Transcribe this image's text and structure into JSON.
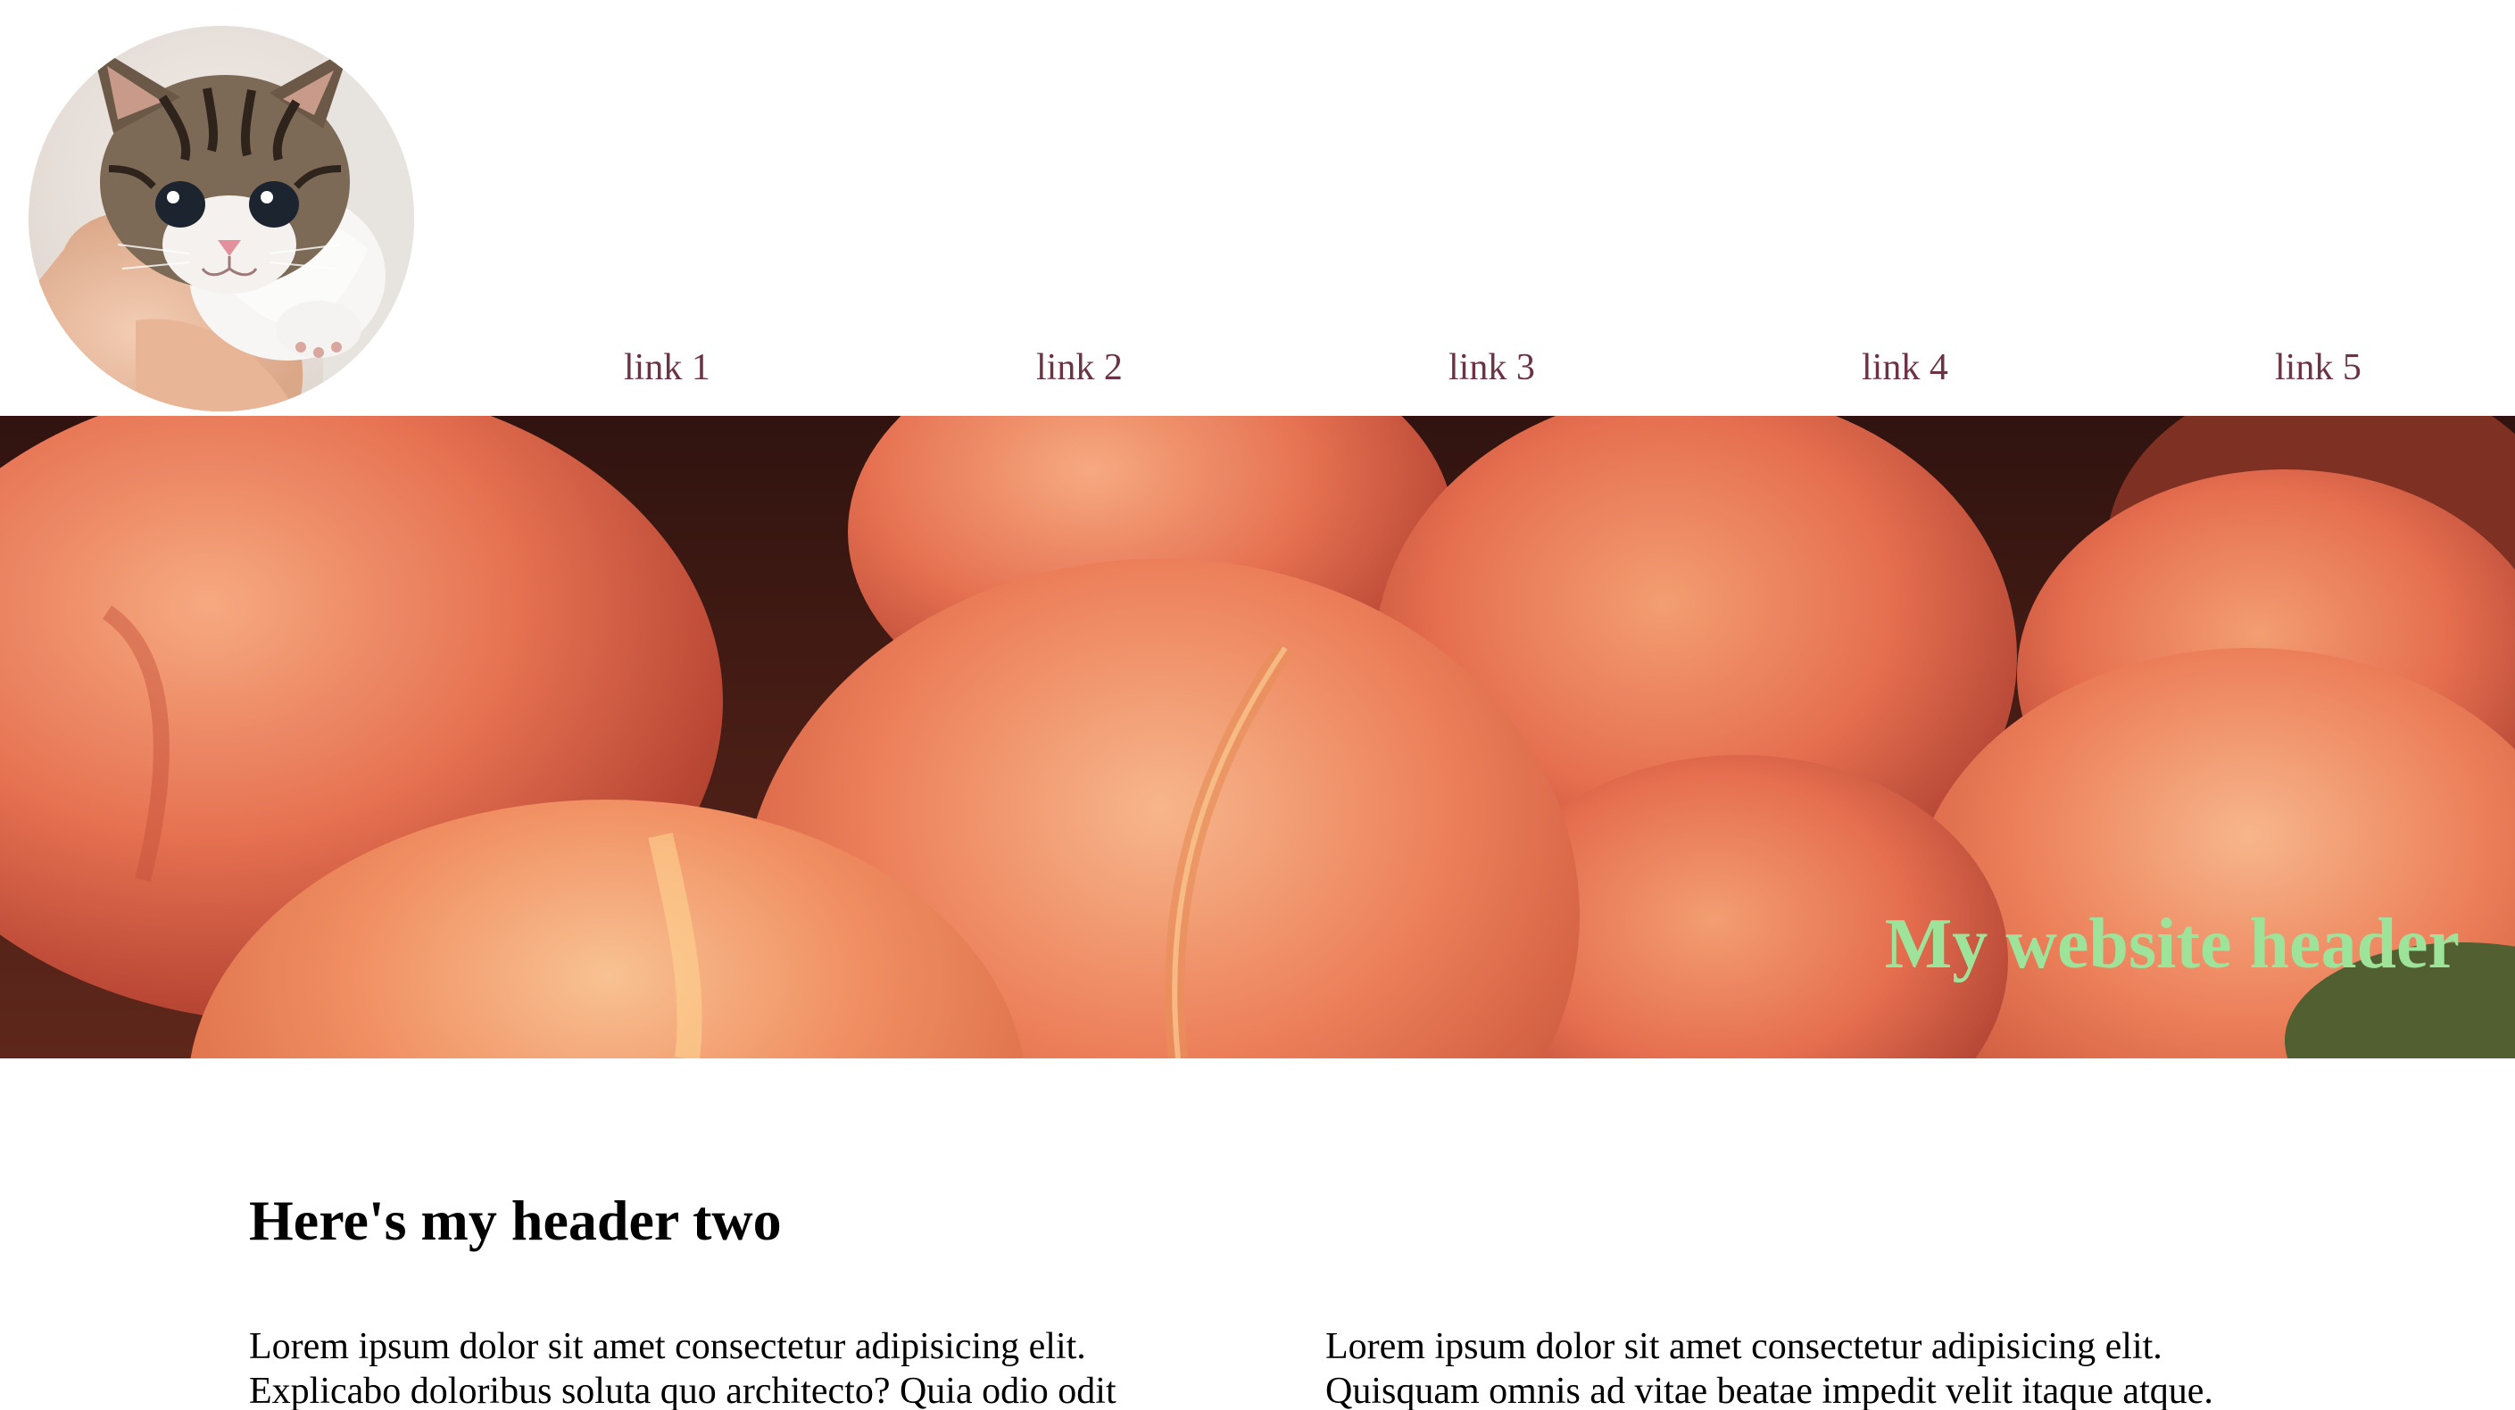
{
  "header": {
    "avatar_icon": "kitten-photo",
    "nav": [
      {
        "label": "link 1"
      },
      {
        "label": "link 2"
      },
      {
        "label": "link 3"
      },
      {
        "label": "link 4"
      },
      {
        "label": "link 5"
      }
    ],
    "link_color": "#6b3344"
  },
  "hero": {
    "image_icon": "peaches-photo",
    "title": "My website header",
    "title_color": "#9de39a"
  },
  "main": {
    "heading": "Here's my header two",
    "columns": [
      {
        "lines": [
          "Lorem ipsum dolor sit amet consectetur adipisicing elit.",
          "Explicabo doloribus soluta quo architecto? Quia odio odit"
        ]
      },
      {
        "lines": [
          "Lorem ipsum dolor sit amet consectetur adipisicing elit.",
          "Quisquam omnis ad vitae beatae impedit velit itaque atque."
        ]
      }
    ]
  }
}
